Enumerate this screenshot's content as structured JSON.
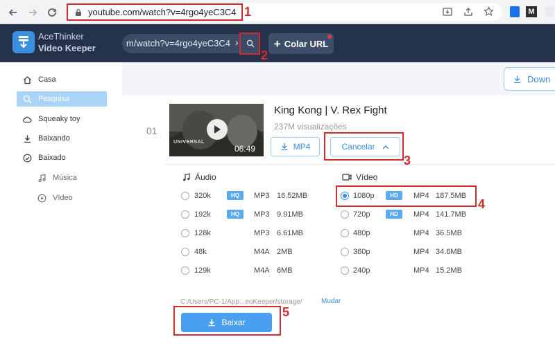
{
  "browser": {
    "url": "youtube.com/watch?v=4rgo4yeC3C4"
  },
  "app": {
    "brand_line1": "AceThinker",
    "brand_line2": "Video Keeper",
    "search_value": "m/watch?v=4rgo4yeC3C4",
    "paste_label": "Colar URL",
    "download_tab_label": "Down"
  },
  "sidebar": {
    "items": [
      {
        "label": "Casa",
        "icon": "home-icon"
      },
      {
        "label": "Pesquisa",
        "icon": "search-icon",
        "active": true
      },
      {
        "label": "Squeaky toy",
        "icon": "cloud-icon"
      },
      {
        "label": "Baixando",
        "icon": "download-icon"
      },
      {
        "label": "Baixado",
        "icon": "check-circle-icon"
      },
      {
        "label": "Música",
        "icon": "music-icon"
      },
      {
        "label": "Vídeo",
        "icon": "play-circle-icon"
      }
    ]
  },
  "video": {
    "index": "01",
    "title": "King Kong | V. Rex Fight",
    "views": "237M visualizações",
    "duration": "06:49",
    "thumb_brand": "UNIVERSAL",
    "mp4_label": "MP4",
    "cancel_label": "Cancelar"
  },
  "audio": {
    "header": "Áudio",
    "rows": [
      {
        "quality": "320k",
        "badge": "HQ",
        "format": "MP3",
        "size": "16.52MB",
        "selected": false
      },
      {
        "quality": "192k",
        "badge": "HQ",
        "format": "MP3",
        "size": "9.91MB",
        "selected": false
      },
      {
        "quality": "128k",
        "badge": "",
        "format": "MP3",
        "size": "6.61MB",
        "selected": false
      },
      {
        "quality": "48k",
        "badge": "",
        "format": "M4A",
        "size": "2MB",
        "selected": false
      },
      {
        "quality": "129k",
        "badge": "",
        "format": "M4A",
        "size": "6MB",
        "selected": false
      }
    ]
  },
  "videoFormats": {
    "header": "Vídeo",
    "rows": [
      {
        "quality": "1080p",
        "badge": "HD",
        "format": "MP4",
        "size": "187.5MB",
        "selected": true
      },
      {
        "quality": "720p",
        "badge": "HD",
        "format": "MP4",
        "size": "141.7MB",
        "selected": false
      },
      {
        "quality": "480p",
        "badge": "",
        "format": "MP4",
        "size": "36.5MB",
        "selected": false
      },
      {
        "quality": "360p",
        "badge": "",
        "format": "MP4",
        "size": "34.6MB",
        "selected": false
      },
      {
        "quality": "240p",
        "badge": "",
        "format": "MP4",
        "size": "15.2MB",
        "selected": false
      }
    ]
  },
  "output": {
    "path": "C:/Users/PC-1/App...eoKeeper/storage/",
    "change_label": "Mudar",
    "download_label": "Baixar"
  },
  "annotations": [
    "1",
    "2",
    "3",
    "4",
    "5"
  ],
  "colors": {
    "header_bg": "#25324b",
    "accent": "#3a8ee6",
    "annotation": "#d22b2b"
  }
}
